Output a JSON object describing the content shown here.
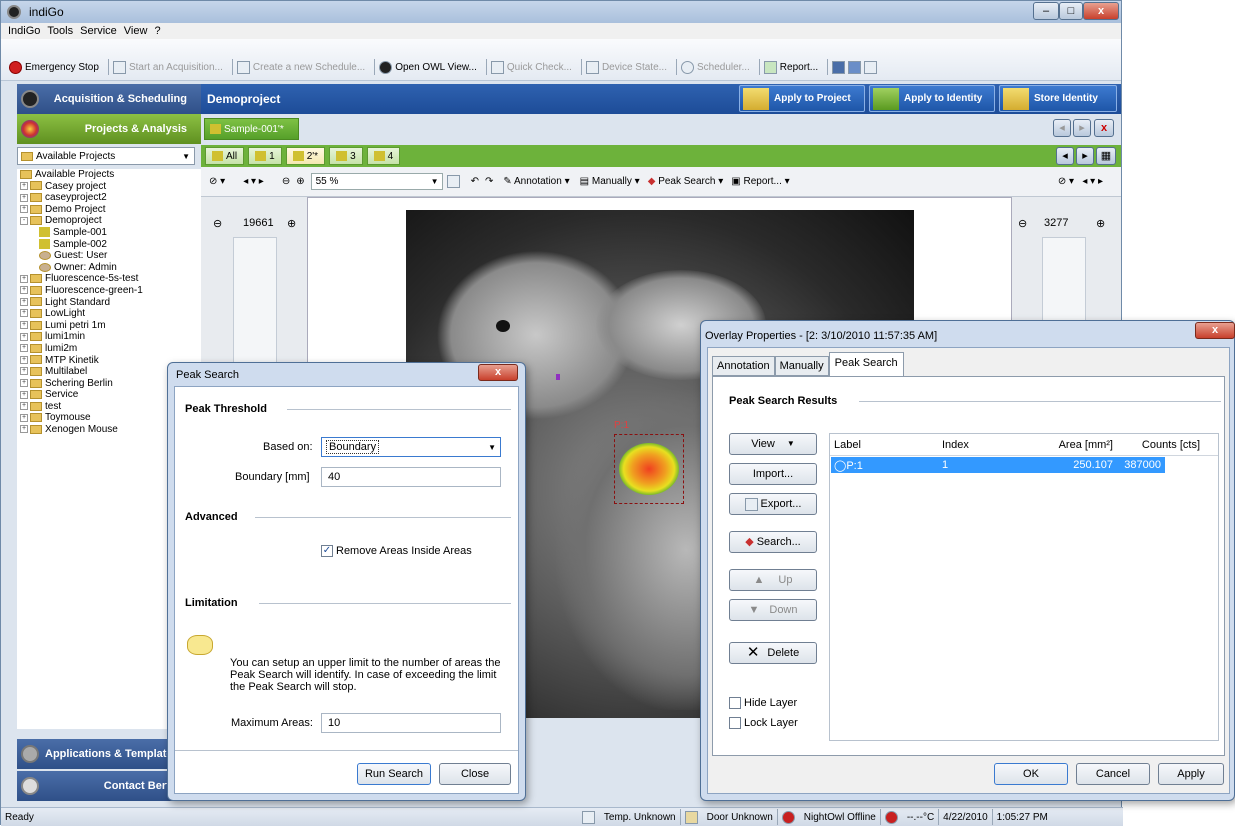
{
  "app": {
    "title": "indiGo"
  },
  "window_controls": {
    "min": "–",
    "max": "□",
    "close": "x"
  },
  "menu": [
    "IndiGo",
    "Tools",
    "Service",
    "View",
    "?"
  ],
  "toolbar": {
    "emergency_stop": "Emergency Stop",
    "start_acquisition": "Start an Acquisition...",
    "create_schedule": "Create a new Schedule...",
    "open_owl": "Open OWL View...",
    "quick_check": "Quick Check...",
    "device_state": "Device State...",
    "scheduler": "Scheduler...",
    "report": "Report..."
  },
  "nav": {
    "acquisition": "Acquisition & Scheduling",
    "projects": "Projects & Analysis",
    "applications": "Applications & Templates",
    "contact": "Contact Berthold"
  },
  "project_selector": "Available Projects",
  "tree": [
    {
      "label": "Available Projects",
      "level": 0,
      "icon": "folder"
    },
    {
      "label": "Casey project",
      "level": 1,
      "icon": "project",
      "exp": "+"
    },
    {
      "label": "caseyproject2",
      "level": 1,
      "icon": "project",
      "exp": "+"
    },
    {
      "label": "Demo Project",
      "level": 1,
      "icon": "project",
      "exp": "+"
    },
    {
      "label": "Demoproject",
      "level": 1,
      "icon": "project",
      "exp": "-"
    },
    {
      "label": "Sample-001",
      "level": 2,
      "icon": "sample"
    },
    {
      "label": "Sample-002",
      "level": 2,
      "icon": "sample"
    },
    {
      "label": "Guest: User",
      "level": 2,
      "icon": "user"
    },
    {
      "label": "Owner: Admin",
      "level": 2,
      "icon": "user"
    },
    {
      "label": "Fluorescence-5s-test",
      "level": 1,
      "icon": "project",
      "exp": "+"
    },
    {
      "label": "Fluorescence-green-1",
      "level": 1,
      "icon": "project",
      "exp": "+"
    },
    {
      "label": "Light Standard",
      "level": 1,
      "icon": "project",
      "exp": "+"
    },
    {
      "label": "LowLight",
      "level": 1,
      "icon": "project",
      "exp": "+"
    },
    {
      "label": "Lumi petri 1m",
      "level": 1,
      "icon": "project",
      "exp": "+"
    },
    {
      "label": "lumi1min",
      "level": 1,
      "icon": "project",
      "exp": "+"
    },
    {
      "label": "lumi2m",
      "level": 1,
      "icon": "project",
      "exp": "+"
    },
    {
      "label": "MTP Kinetik",
      "level": 1,
      "icon": "project",
      "exp": "+"
    },
    {
      "label": "Multilabel",
      "level": 1,
      "icon": "project",
      "exp": "+"
    },
    {
      "label": "Schering Berlin",
      "level": 1,
      "icon": "project",
      "exp": "+"
    },
    {
      "label": "Service",
      "level": 1,
      "icon": "project",
      "exp": "+"
    },
    {
      "label": "test",
      "level": 1,
      "icon": "project",
      "exp": "+"
    },
    {
      "label": "Toymouse",
      "level": 1,
      "icon": "project",
      "exp": "+"
    },
    {
      "label": "Xenogen Mouse",
      "level": 1,
      "icon": "project",
      "exp": "+"
    }
  ],
  "project": {
    "title": "Demoproject",
    "apply_project": "Apply to Project",
    "apply_identity": "Apply to Identity",
    "store_identity": "Store Identity"
  },
  "sample_tab": "Sample-001'*",
  "image_tabs": [
    "All",
    "1",
    "2'*",
    "3",
    "4"
  ],
  "image_toolbar": {
    "zoom": "55 %",
    "annotation": "Annotation",
    "manually": "Manually",
    "peak_search": "Peak Search",
    "report": "Report..."
  },
  "rulers": {
    "left_value": "19661",
    "right_value": "3277"
  },
  "overlay_label": "P:1",
  "statusbar": {
    "ready": "Ready",
    "temp": "Temp. Unknown",
    "door": "Door Unknown",
    "nightowl": "NightOwl Offline",
    "temp_value": "--.--°C",
    "date": "4/22/2010",
    "time": "1:05:27 PM"
  },
  "peak_dialog": {
    "title": "Peak Search",
    "threshold_header": "Peak Threshold",
    "based_on_label": "Based on:",
    "based_on_value": "Boundary",
    "boundary_label": "Boundary [mm]",
    "boundary_value": "40",
    "advanced_header": "Advanced",
    "remove_areas": "Remove Areas Inside Areas",
    "limitation_header": "Limitation",
    "limitation_text": "You can setup an upper limit to the number of areas the Peak Search will identify. In case of exceeding the limit the Peak Search will stop.",
    "max_areas_label": "Maximum Areas:",
    "max_areas_value": "10",
    "run": "Run Search",
    "close": "Close",
    "close_x": "x"
  },
  "overlay_dialog": {
    "title": "Overlay Properties - [2: 3/10/2010 11:57:35 AM]",
    "tabs": [
      "Annotation",
      "Manually",
      "Peak Search"
    ],
    "results_header": "Peak Search Results",
    "buttons": {
      "view": "View",
      "import": "Import...",
      "export": "Export...",
      "search": "Search...",
      "up": "Up",
      "down": "Down",
      "delete": "Delete"
    },
    "hide_layer": "Hide Layer",
    "lock_layer": "Lock Layer",
    "columns": [
      "Label",
      "Index",
      "Area [mm²]",
      "Counts [cts]"
    ],
    "rows": [
      [
        "P:1",
        "1",
        "250.107",
        "387000"
      ]
    ],
    "ok": "OK",
    "cancel": "Cancel",
    "apply": "Apply",
    "close_x": "x"
  },
  "colors": {
    "nav_blue": "#2f5088",
    "nav_green": "#6db23b",
    "selection": "#3399ff"
  }
}
